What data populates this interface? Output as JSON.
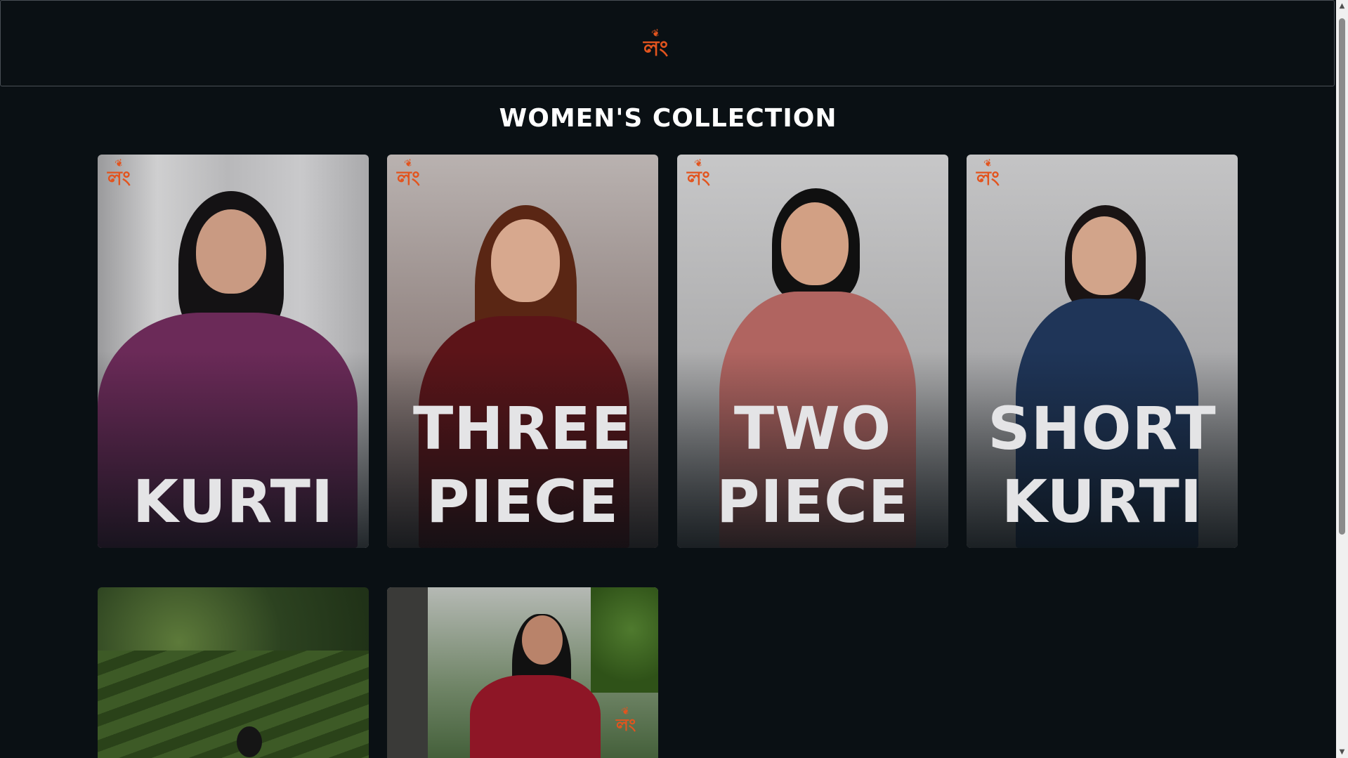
{
  "header": {
    "logo_text": "লং",
    "logo_sprig": "❦"
  },
  "page_title": "Women's Collection",
  "cards": [
    {
      "label_line1": "",
      "label_line2": "Kurti",
      "logo_text": "লং"
    },
    {
      "label_line1": "Three",
      "label_line2": "Piece",
      "logo_text": "লং"
    },
    {
      "label_line1": "Two",
      "label_line2": "Piece",
      "logo_text": "লং"
    },
    {
      "label_line1": "Short",
      "label_line2": "Kurti",
      "logo_text": "লং"
    }
  ],
  "lower_cards": [
    {
      "logo_text": ""
    },
    {
      "logo_text": "লং"
    }
  ],
  "scrollbar": {
    "up_arrow": "▲",
    "down_arrow": "▼"
  },
  "colors": {
    "background": "#0a1014",
    "brand_orange": "#e2541e",
    "label_text": "#e4e4e6"
  }
}
